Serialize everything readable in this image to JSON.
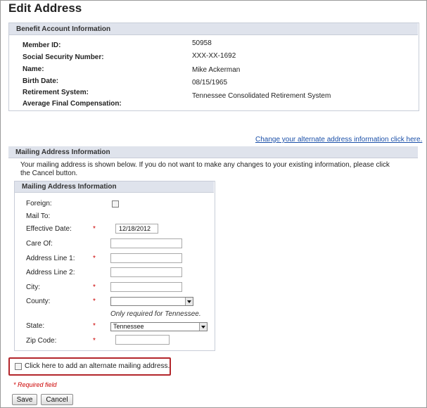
{
  "page": {
    "title": "Edit Address"
  },
  "benefit": {
    "header": "Benefit Account Information",
    "fields": [
      {
        "label": "Member ID:",
        "value": "50958"
      },
      {
        "label": "Social Security Number:",
        "value": "XXX-XX-1692"
      },
      {
        "label": "Name:",
        "value": "Mike Ackerman"
      },
      {
        "label": "Birth Date:",
        "value": "08/15/1965"
      },
      {
        "label": "Retirement System:",
        "value": "Tennessee Consolidated Retirement System"
      },
      {
        "label": "Average Final Compensation:",
        "value": ""
      }
    ]
  },
  "links": {
    "alternate": "Change your alternate address information click here."
  },
  "mailing": {
    "header": "Mailing Address Information",
    "instructions_line1": "Your mailing address is shown below. If you do not want to make any changes to your existing information, please click",
    "instructions_line2": "the Cancel button.",
    "inner_header": "Mailing Address Information",
    "foreign_label": "Foreign:",
    "mail_to_label": "Mail To:",
    "effective_date_label": "Effective Date:",
    "effective_date_value": "12/18/2012",
    "care_of_label": "Care Of:",
    "address1_label": "Address Line 1:",
    "address2_label": "Address Line 2:",
    "city_label": "City:",
    "county_label": "County:",
    "county_value": "",
    "county_hint": "Only required for Tennessee.",
    "state_label": "State:",
    "state_value": "Tennessee",
    "zip_label": "Zip Code:",
    "required_mark": "*"
  },
  "alternate": {
    "checkbox_label": "Click here to add an alternate mailing address."
  },
  "footer": {
    "required_note": "* Required field",
    "save_label": "Save",
    "cancel_label": "Cancel"
  },
  "colors": {
    "accent_red": "#cc0000",
    "link_blue": "#1a4fa8",
    "header_bg": "#dfe3ec",
    "highlight_border": "#b3262b"
  }
}
